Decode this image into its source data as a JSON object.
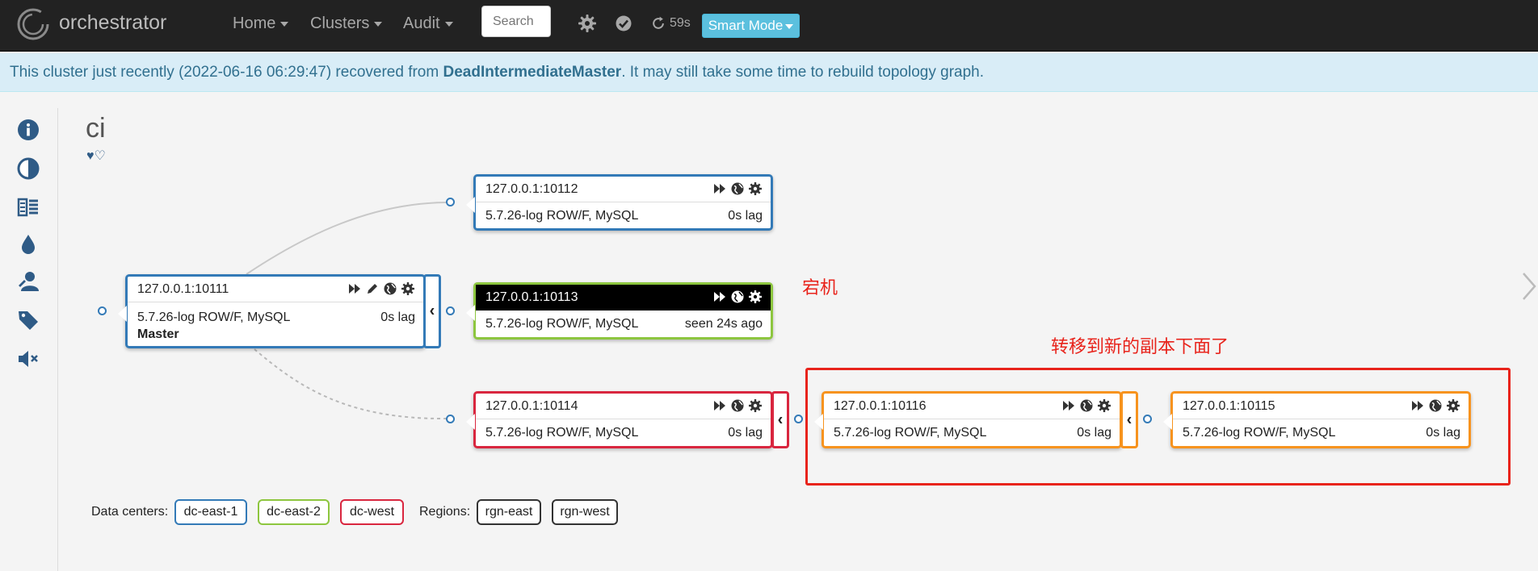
{
  "navbar": {
    "brand": "orchestrator",
    "menu": [
      {
        "label": "Home"
      },
      {
        "label": "Clusters"
      },
      {
        "label": "Audit"
      }
    ],
    "search_placeholder": "Search",
    "refresh_countdown": "59s",
    "mode_button": "Smart Mode"
  },
  "alert": {
    "prefix": "This cluster just recently (2022-06-16 06:29:47) recovered from ",
    "analysis": "DeadIntermediateMaster",
    "suffix": ". It may still take some time to rebuild topology graph."
  },
  "cluster": {
    "title": "ci",
    "hearts": "♥♡"
  },
  "nodes": {
    "n10111": {
      "name": "127.0.0.1:10111",
      "version": "5.7.26-log ROW/F, MySQL",
      "lag": "0s lag",
      "role": "Master",
      "border": "#337ab7"
    },
    "n10112": {
      "name": "127.0.0.1:10112",
      "version": "5.7.26-log ROW/F, MySQL",
      "lag": "0s lag",
      "border": "#337ab7"
    },
    "n10113": {
      "name": "127.0.0.1:10113",
      "version": "5.7.26-log ROW/F, MySQL",
      "lag": "seen 24s ago",
      "border": "#8dc63f"
    },
    "n10114": {
      "name": "127.0.0.1:10114",
      "version": "5.7.26-log ROW/F, MySQL",
      "lag": "0s lag",
      "border": "#d9263f"
    },
    "n10116": {
      "name": "127.0.0.1:10116",
      "version": "5.7.26-log ROW/F, MySQL",
      "lag": "0s lag",
      "border": "#f7931e"
    },
    "n10115": {
      "name": "127.0.0.1:10115",
      "version": "5.7.26-log ROW/F, MySQL",
      "lag": "0s lag",
      "border": "#f7931e"
    }
  },
  "annotations": {
    "down": "宕机",
    "moved": "转移到新的副本下面了"
  },
  "legend": {
    "data_centers_label": "Data centers:",
    "data_centers": [
      {
        "label": "dc-east-1",
        "color": "#337ab7"
      },
      {
        "label": "dc-east-2",
        "color": "#8dc63f"
      },
      {
        "label": "dc-west",
        "color": "#d9263f"
      }
    ],
    "regions_label": "Regions:",
    "regions": [
      {
        "label": "rgn-east",
        "color": "#333333"
      },
      {
        "label": "rgn-west",
        "color": "#333333"
      }
    ]
  },
  "colors": {
    "navbar_bg": "#222222",
    "alert_bg": "#d9edf7",
    "alert_text": "#31708f",
    "smart_mode": "#5bc0de",
    "annotation": "#e8231b"
  },
  "icons": {
    "logo": "orchestrator-logo-icon",
    "settings": "gear-icon",
    "problems": "check-circle-icon",
    "refresh": "refresh-icon",
    "sidebar": [
      "info-icon",
      "contrast-icon",
      "layers-icon",
      "drop-icon",
      "user-edit-icon",
      "tag-icon",
      "mute-icon"
    ],
    "node": [
      "fast-forward-icon",
      "pencil-icon",
      "globe-icon",
      "gear-icon"
    ]
  }
}
